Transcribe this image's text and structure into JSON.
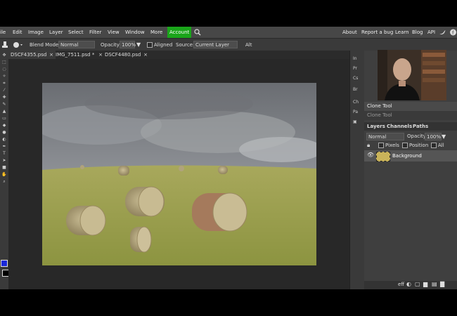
{
  "menu": {
    "items": [
      {
        "label": "ile"
      },
      {
        "label": "Edit"
      },
      {
        "label": "Image"
      },
      {
        "label": "Layer"
      },
      {
        "label": "Select"
      },
      {
        "label": "Filter"
      },
      {
        "label": "View"
      },
      {
        "label": "Window"
      },
      {
        "label": "More"
      }
    ],
    "account_label": "Account",
    "right_items": [
      {
        "label": "About"
      },
      {
        "label": "Report a bug"
      },
      {
        "label": "Learn"
      },
      {
        "label": "Blog"
      },
      {
        "label": "API"
      }
    ]
  },
  "options": {
    "blend_mode_label": "Blend Mode:",
    "blend_mode_value": "Normal",
    "opacity_label": "Opacity:",
    "opacity_value": "100%",
    "aligned_label": "Aligned",
    "source_label": "Source:",
    "source_value": "Current Layer",
    "alt_label": "Alt"
  },
  "tabs": [
    {
      "label": "DSCF4355.psd",
      "close": "×"
    },
    {
      "label": "IMG_7511.psd *",
      "close": "×"
    },
    {
      "label": "DSCF4480.psd",
      "close": "×"
    }
  ],
  "collapsed_panel": [
    "In",
    "Pr",
    "Cs",
    "Br",
    "Ch",
    "Pa"
  ],
  "history": {
    "items": [
      {
        "label": "Clone Tool"
      },
      {
        "label": "Clone Tool"
      }
    ]
  },
  "layers_panel": {
    "tabs": [
      {
        "label": "Layers"
      },
      {
        "label": "Channels"
      },
      {
        "label": "Paths"
      }
    ],
    "blend_value": "Normal",
    "opacity_label": "Opacity:",
    "opacity_value": "100%",
    "lock_pixels": "Pixels",
    "lock_position": "Position",
    "lock_all": "All",
    "layer_name": "Background",
    "bottom_label": "eff"
  },
  "colors": {
    "accent_green": "#1aa51a",
    "panel_bg": "#3a3a3a",
    "menubar_bg": "#474747",
    "foreground_swatch": "#1a28d8",
    "background_swatch": "#000000"
  }
}
